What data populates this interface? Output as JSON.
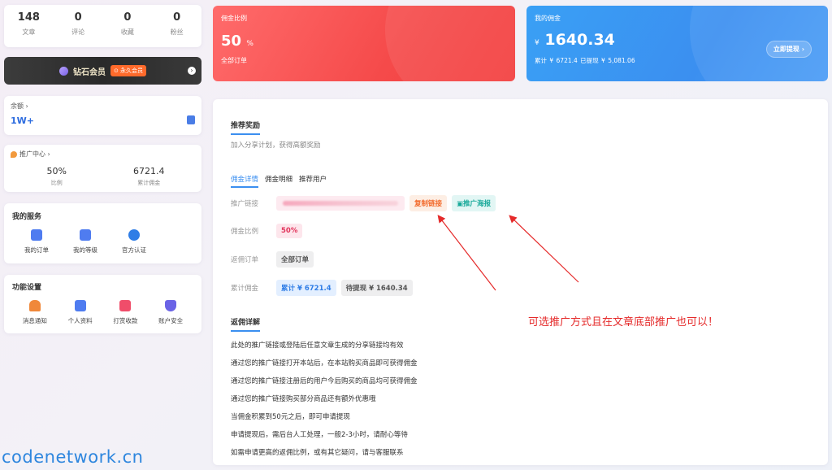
{
  "stats": [
    {
      "value": "148",
      "label": "文章"
    },
    {
      "value": "0",
      "label": "评论"
    },
    {
      "value": "0",
      "label": "收藏"
    },
    {
      "value": "0",
      "label": "粉丝"
    }
  ],
  "vip": {
    "title": "钻石会员",
    "badge": "⊙ 永久会员",
    "arrow": "›"
  },
  "balance": {
    "label": "余额 ›",
    "value": "1W+"
  },
  "promo_center": {
    "title": "推广中心 ›",
    "items": [
      {
        "value": "50%",
        "label": "比例"
      },
      {
        "value": "6721.4",
        "label": "累计佣金"
      }
    ]
  },
  "services": {
    "title": "我的服务",
    "items": [
      {
        "label": "我的订单",
        "icon": "clipboard-icon",
        "color": "#4f7cf0"
      },
      {
        "label": "我的等级",
        "icon": "chart-icon",
        "color": "#4f7cf0"
      },
      {
        "label": "官方认证",
        "icon": "verified-icon",
        "color": "#2f7de6"
      }
    ]
  },
  "functions": {
    "title": "功能设置",
    "items": [
      {
        "label": "消息通知",
        "icon": "bell-icon",
        "color": "#f0883a"
      },
      {
        "label": "个人资料",
        "icon": "profile-icon",
        "color": "#4f7cf0"
      },
      {
        "label": "打赏收款",
        "icon": "gift-icon",
        "color": "#f04d6a"
      },
      {
        "label": "账户安全",
        "icon": "shield-icon",
        "color": "#6a63e6"
      }
    ]
  },
  "commission_rate_card": {
    "title": "佣金比例",
    "value": "50",
    "unit": "%",
    "sub": "全部订单"
  },
  "my_commission_card": {
    "title": "我的佣金",
    "currency": "¥",
    "value": "1640.34",
    "sub": "累计 ¥ 6721.4    已提现 ¥ 5,081.06",
    "button": "立即提现 ›"
  },
  "main": {
    "section_title": "推荐奖励",
    "subtitle": "加入分享计划，获得高额奖励",
    "tabs": [
      "佣金详情",
      "佣金明细",
      "推荐用户"
    ],
    "link_label": "推广链接",
    "copy_link": "复制链接",
    "poster": "推广海报",
    "rate_label": "佣金比例",
    "rate_value": "50%",
    "rebate_label": "返佣订单",
    "rebate_value": "全部订单",
    "total_label": "累计佣金",
    "total_value": "累计 ¥ 6721.4",
    "pending_value": "待提现 ¥ 1640.34",
    "rules_title": "返佣详解",
    "rules": [
      "此处的推广链接或登陆后任意文章生成的分享链接均有效",
      "通过您的推广链接打开本站后，在本站购买商品即可获得佣金",
      "通过您的推广链接注册后的用户今后购买的商品均可获得佣金",
      "通过您的推广链接购买部分商品还有额外优惠哦",
      "当佣金积累到50元之后，即可申请提现",
      "申请提现后，需后台人工处理，一般2-3小时，请耐心等待",
      "如需申请更高的返佣比例，或有其它疑问，请与客服联系"
    ],
    "annotation": "可选推广方式且在文章底部推广也可以！"
  },
  "watermark": "codenetwork.cn",
  "colors": {
    "accent_blue": "#3b8ff0",
    "red_card": "#f54a4a",
    "annotation_red": "#e52a2a"
  }
}
